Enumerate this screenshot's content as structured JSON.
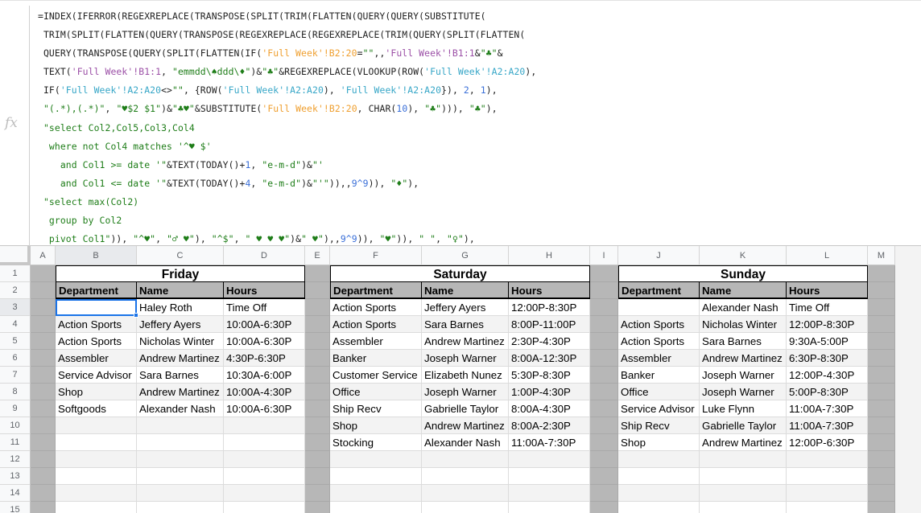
{
  "formula_bar": {
    "icon": "fx-icon",
    "lines": [
      [
        {
          "t": "=INDEX(IFERROR(REGEXREPLACE(TRANSPOSE(SPLIT(TRIM(FLATTEN(QUERY(QUERY(SUBSTITUTE(",
          "c": ""
        }
      ],
      [
        {
          "t": " TRIM(SPLIT(FLATTEN(QUERY(TRANSPOSE(REGEXREPLACE(REGEXREPLACE(TRIM(QUERY(SPLIT(FLATTEN(",
          "c": ""
        }
      ],
      [
        {
          "t": " QUERY(TRANSPOSE(QUERY(SPLIT(FLATTEN(IF(",
          "c": ""
        },
        {
          "t": "'Full Week'!B2:20",
          "c": "t-ref1"
        },
        {
          "t": "=",
          "c": ""
        },
        {
          "t": "\"\"",
          "c": "t-str"
        },
        {
          "t": ",,",
          "c": ""
        },
        {
          "t": "'Full Week'!B1:1",
          "c": "t-ref2"
        },
        {
          "t": "&",
          "c": ""
        },
        {
          "t": "\"♣\"",
          "c": "t-str"
        },
        {
          "t": "&",
          "c": ""
        }
      ],
      [
        {
          "t": " TEXT(",
          "c": ""
        },
        {
          "t": "'Full Week'!B1:1",
          "c": "t-ref2"
        },
        {
          "t": ", ",
          "c": ""
        },
        {
          "t": "\"emmdd\\♠ddd\\♦\"",
          "c": "t-str"
        },
        {
          "t": ")&",
          "c": ""
        },
        {
          "t": "\"♣\"",
          "c": "t-str"
        },
        {
          "t": "&REGEXREPLACE(VLOOKUP(ROW(",
          "c": ""
        },
        {
          "t": "'Full Week'!A2:A20",
          "c": "t-ref3"
        },
        {
          "t": "),",
          "c": ""
        }
      ],
      [
        {
          "t": " IF(",
          "c": ""
        },
        {
          "t": "'Full Week'!A2:A20",
          "c": "t-ref3"
        },
        {
          "t": "<>",
          "c": ""
        },
        {
          "t": "\"\"",
          "c": "t-str"
        },
        {
          "t": ", {ROW(",
          "c": ""
        },
        {
          "t": "'Full Week'!A2:A20",
          "c": "t-ref3"
        },
        {
          "t": "), ",
          "c": ""
        },
        {
          "t": "'Full Week'!A2:A20",
          "c": "t-ref3"
        },
        {
          "t": "}), ",
          "c": ""
        },
        {
          "t": "2",
          "c": "t-num"
        },
        {
          "t": ", ",
          "c": ""
        },
        {
          "t": "1",
          "c": "t-num"
        },
        {
          "t": "),",
          "c": ""
        }
      ],
      [
        {
          "t": " ",
          "c": ""
        },
        {
          "t": "\"(.*),(.*)\"",
          "c": "t-str"
        },
        {
          "t": ", ",
          "c": ""
        },
        {
          "t": "\"♥$2 $1\"",
          "c": "t-str"
        },
        {
          "t": ")&",
          "c": ""
        },
        {
          "t": "\"♣♥\"",
          "c": "t-str"
        },
        {
          "t": "&SUBSTITUTE(",
          "c": ""
        },
        {
          "t": "'Full Week'!B2:20",
          "c": "t-ref1"
        },
        {
          "t": ", CHAR(",
          "c": ""
        },
        {
          "t": "10",
          "c": "t-num"
        },
        {
          "t": "), ",
          "c": ""
        },
        {
          "t": "\"♣\"",
          "c": "t-str"
        },
        {
          "t": "))), ",
          "c": ""
        },
        {
          "t": "\"♣\"",
          "c": "t-str"
        },
        {
          "t": "),",
          "c": ""
        }
      ],
      [
        {
          "t": " \"select Col2,Col5,Col3,Col4",
          "c": "t-str"
        }
      ],
      [
        {
          "t": "  where not Col4 matches '^♥ $'",
          "c": "t-str"
        }
      ],
      [
        {
          "t": "    and Col1 >= date '\"",
          "c": "t-str"
        },
        {
          "t": "&TEXT(TODAY()+",
          "c": ""
        },
        {
          "t": "1",
          "c": "t-num"
        },
        {
          "t": ", ",
          "c": ""
        },
        {
          "t": "\"e-m-d\"",
          "c": "t-str"
        },
        {
          "t": ")&",
          "c": ""
        },
        {
          "t": "\"'",
          "c": "t-str"
        }
      ],
      [
        {
          "t": "    and Col1 <= date '\"",
          "c": "t-str"
        },
        {
          "t": "&TEXT(TODAY()+",
          "c": ""
        },
        {
          "t": "4",
          "c": "t-num"
        },
        {
          "t": ", ",
          "c": ""
        },
        {
          "t": "\"e-m-d\"",
          "c": "t-str"
        },
        {
          "t": ")&",
          "c": ""
        },
        {
          "t": "\"'\"",
          "c": "t-str"
        },
        {
          "t": ")),,",
          "c": ""
        },
        {
          "t": "9^9",
          "c": "t-num"
        },
        {
          "t": ")), ",
          "c": ""
        },
        {
          "t": "\"♦\"",
          "c": "t-str"
        },
        {
          "t": "),",
          "c": ""
        }
      ],
      [
        {
          "t": " \"select max(Col2)",
          "c": "t-str"
        }
      ],
      [
        {
          "t": "  group by Col2",
          "c": "t-str"
        }
      ],
      [
        {
          "t": "  pivot Col1\"",
          "c": "t-str"
        },
        {
          "t": ")), ",
          "c": ""
        },
        {
          "t": "\"^♥\"",
          "c": "t-str"
        },
        {
          "t": ", ",
          "c": ""
        },
        {
          "t": "\"♂ ♥\"",
          "c": "t-str"
        },
        {
          "t": "), ",
          "c": ""
        },
        {
          "t": "\"^$\"",
          "c": "t-str"
        },
        {
          "t": ", ",
          "c": ""
        },
        {
          "t": "\" ♥ ♥ ♥\"",
          "c": "t-str"
        },
        {
          "t": ")&",
          "c": ""
        },
        {
          "t": "\" ♥\"",
          "c": "t-str"
        },
        {
          "t": "),,",
          "c": ""
        },
        {
          "t": "9^9",
          "c": "t-num"
        },
        {
          "t": ")), ",
          "c": ""
        },
        {
          "t": "\"♥\"",
          "c": "t-str"
        },
        {
          "t": ")), ",
          "c": ""
        },
        {
          "t": "\" \"",
          "c": "t-str"
        },
        {
          "t": ", ",
          "c": ""
        },
        {
          "t": "\"♀\"",
          "c": "t-str"
        },
        {
          "t": "),",
          "c": ""
        }
      ]
    ]
  },
  "grid": {
    "columns": [
      "A",
      "B",
      "C",
      "D",
      "E",
      "F",
      "G",
      "H",
      "I",
      "J",
      "K",
      "L",
      "M"
    ],
    "rows": [
      "1",
      "2",
      "3",
      "4",
      "5",
      "6",
      "7",
      "8",
      "9",
      "10",
      "11",
      "12",
      "13",
      "14",
      "15"
    ],
    "selected_cell": "B3",
    "days": [
      {
        "title": "Friday",
        "headers": [
          "Department",
          "Name",
          "Hours"
        ],
        "rows": [
          [
            "",
            "Haley Roth",
            "Time Off"
          ],
          [
            "Action Sports",
            "Jeffery Ayers",
            "10:00A-6:30P"
          ],
          [
            "Action Sports",
            "Nicholas Winter",
            "10:00A-6:30P"
          ],
          [
            "Assembler",
            "Andrew Martinez",
            "4:30P-6:30P"
          ],
          [
            "Service Advisor",
            "Sara Barnes",
            "10:30A-6:00P"
          ],
          [
            "Shop",
            "Andrew Martinez",
            "10:00A-4:30P"
          ],
          [
            "Softgoods",
            "Alexander Nash",
            "10:00A-6:30P"
          ]
        ]
      },
      {
        "title": "Saturday",
        "headers": [
          "Department",
          "Name",
          "Hours"
        ],
        "rows": [
          [
            "Action Sports",
            "Jeffery Ayers",
            "12:00P-8:30P"
          ],
          [
            "Action Sports",
            "Sara Barnes",
            "8:00P-11:00P"
          ],
          [
            "Assembler",
            "Andrew Martinez",
            "2:30P-4:30P"
          ],
          [
            "Banker",
            "Joseph Warner",
            "8:00A-12:30P"
          ],
          [
            "Customer Service",
            "Elizabeth Nunez",
            "5:30P-8:30P"
          ],
          [
            "Office",
            "Joseph Warner",
            "1:00P-4:30P"
          ],
          [
            "Ship Recv",
            "Gabrielle Taylor",
            "8:00A-4:30P"
          ],
          [
            "Shop",
            "Andrew Martinez",
            "8:00A-2:30P"
          ],
          [
            "Stocking",
            "Alexander Nash",
            "11:00A-7:30P"
          ]
        ]
      },
      {
        "title": "Sunday",
        "headers": [
          "Department",
          "Name",
          "Hours"
        ],
        "rows": [
          [
            "",
            "Alexander Nash",
            "Time Off"
          ],
          [
            "Action Sports",
            "Nicholas Winter",
            "12:00P-8:30P"
          ],
          [
            "Action Sports",
            "Sara Barnes",
            "9:30A-5:00P"
          ],
          [
            "Assembler",
            "Andrew Martinez",
            "6:30P-8:30P"
          ],
          [
            "Banker",
            "Joseph Warner",
            "12:00P-4:30P"
          ],
          [
            "Office",
            "Joseph Warner",
            "5:00P-8:30P"
          ],
          [
            "Service Advisor",
            "Luke Flynn",
            "11:00A-7:30P"
          ],
          [
            "Ship Recv",
            "Gabrielle Taylor",
            "11:00A-7:30P"
          ],
          [
            "Shop",
            "Andrew Martinez",
            "12:00P-6:30P"
          ]
        ]
      }
    ]
  }
}
